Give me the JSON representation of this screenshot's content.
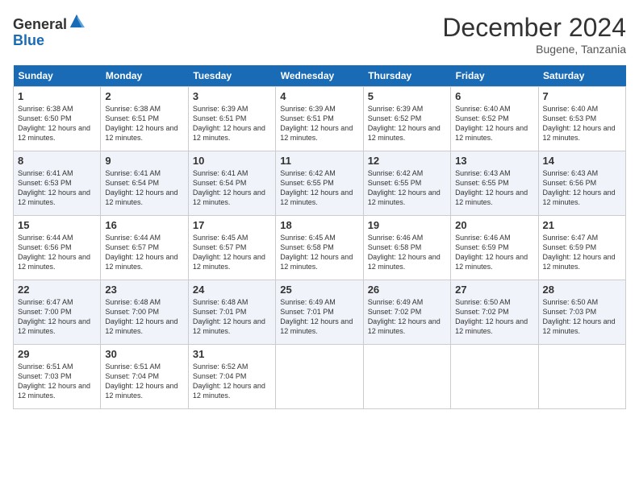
{
  "logo": {
    "general": "General",
    "blue": "Blue"
  },
  "title": "December 2024",
  "location": "Bugene, Tanzania",
  "days_of_week": [
    "Sunday",
    "Monday",
    "Tuesday",
    "Wednesday",
    "Thursday",
    "Friday",
    "Saturday"
  ],
  "weeks": [
    [
      {
        "day": "1",
        "sunrise": "Sunrise: 6:38 AM",
        "sunset": "Sunset: 6:50 PM",
        "daylight": "Daylight: 12 hours and 12 minutes."
      },
      {
        "day": "2",
        "sunrise": "Sunrise: 6:38 AM",
        "sunset": "Sunset: 6:51 PM",
        "daylight": "Daylight: 12 hours and 12 minutes."
      },
      {
        "day": "3",
        "sunrise": "Sunrise: 6:39 AM",
        "sunset": "Sunset: 6:51 PM",
        "daylight": "Daylight: 12 hours and 12 minutes."
      },
      {
        "day": "4",
        "sunrise": "Sunrise: 6:39 AM",
        "sunset": "Sunset: 6:51 PM",
        "daylight": "Daylight: 12 hours and 12 minutes."
      },
      {
        "day": "5",
        "sunrise": "Sunrise: 6:39 AM",
        "sunset": "Sunset: 6:52 PM",
        "daylight": "Daylight: 12 hours and 12 minutes."
      },
      {
        "day": "6",
        "sunrise": "Sunrise: 6:40 AM",
        "sunset": "Sunset: 6:52 PM",
        "daylight": "Daylight: 12 hours and 12 minutes."
      },
      {
        "day": "7",
        "sunrise": "Sunrise: 6:40 AM",
        "sunset": "Sunset: 6:53 PM",
        "daylight": "Daylight: 12 hours and 12 minutes."
      }
    ],
    [
      {
        "day": "8",
        "sunrise": "Sunrise: 6:41 AM",
        "sunset": "Sunset: 6:53 PM",
        "daylight": "Daylight: 12 hours and 12 minutes."
      },
      {
        "day": "9",
        "sunrise": "Sunrise: 6:41 AM",
        "sunset": "Sunset: 6:54 PM",
        "daylight": "Daylight: 12 hours and 12 minutes."
      },
      {
        "day": "10",
        "sunrise": "Sunrise: 6:41 AM",
        "sunset": "Sunset: 6:54 PM",
        "daylight": "Daylight: 12 hours and 12 minutes."
      },
      {
        "day": "11",
        "sunrise": "Sunrise: 6:42 AM",
        "sunset": "Sunset: 6:55 PM",
        "daylight": "Daylight: 12 hours and 12 minutes."
      },
      {
        "day": "12",
        "sunrise": "Sunrise: 6:42 AM",
        "sunset": "Sunset: 6:55 PM",
        "daylight": "Daylight: 12 hours and 12 minutes."
      },
      {
        "day": "13",
        "sunrise": "Sunrise: 6:43 AM",
        "sunset": "Sunset: 6:55 PM",
        "daylight": "Daylight: 12 hours and 12 minutes."
      },
      {
        "day": "14",
        "sunrise": "Sunrise: 6:43 AM",
        "sunset": "Sunset: 6:56 PM",
        "daylight": "Daylight: 12 hours and 12 minutes."
      }
    ],
    [
      {
        "day": "15",
        "sunrise": "Sunrise: 6:44 AM",
        "sunset": "Sunset: 6:56 PM",
        "daylight": "Daylight: 12 hours and 12 minutes."
      },
      {
        "day": "16",
        "sunrise": "Sunrise: 6:44 AM",
        "sunset": "Sunset: 6:57 PM",
        "daylight": "Daylight: 12 hours and 12 minutes."
      },
      {
        "day": "17",
        "sunrise": "Sunrise: 6:45 AM",
        "sunset": "Sunset: 6:57 PM",
        "daylight": "Daylight: 12 hours and 12 minutes."
      },
      {
        "day": "18",
        "sunrise": "Sunrise: 6:45 AM",
        "sunset": "Sunset: 6:58 PM",
        "daylight": "Daylight: 12 hours and 12 minutes."
      },
      {
        "day": "19",
        "sunrise": "Sunrise: 6:46 AM",
        "sunset": "Sunset: 6:58 PM",
        "daylight": "Daylight: 12 hours and 12 minutes."
      },
      {
        "day": "20",
        "sunrise": "Sunrise: 6:46 AM",
        "sunset": "Sunset: 6:59 PM",
        "daylight": "Daylight: 12 hours and 12 minutes."
      },
      {
        "day": "21",
        "sunrise": "Sunrise: 6:47 AM",
        "sunset": "Sunset: 6:59 PM",
        "daylight": "Daylight: 12 hours and 12 minutes."
      }
    ],
    [
      {
        "day": "22",
        "sunrise": "Sunrise: 6:47 AM",
        "sunset": "Sunset: 7:00 PM",
        "daylight": "Daylight: 12 hours and 12 minutes."
      },
      {
        "day": "23",
        "sunrise": "Sunrise: 6:48 AM",
        "sunset": "Sunset: 7:00 PM",
        "daylight": "Daylight: 12 hours and 12 minutes."
      },
      {
        "day": "24",
        "sunrise": "Sunrise: 6:48 AM",
        "sunset": "Sunset: 7:01 PM",
        "daylight": "Daylight: 12 hours and 12 minutes."
      },
      {
        "day": "25",
        "sunrise": "Sunrise: 6:49 AM",
        "sunset": "Sunset: 7:01 PM",
        "daylight": "Daylight: 12 hours and 12 minutes."
      },
      {
        "day": "26",
        "sunrise": "Sunrise: 6:49 AM",
        "sunset": "Sunset: 7:02 PM",
        "daylight": "Daylight: 12 hours and 12 minutes."
      },
      {
        "day": "27",
        "sunrise": "Sunrise: 6:50 AM",
        "sunset": "Sunset: 7:02 PM",
        "daylight": "Daylight: 12 hours and 12 minutes."
      },
      {
        "day": "28",
        "sunrise": "Sunrise: 6:50 AM",
        "sunset": "Sunset: 7:03 PM",
        "daylight": "Daylight: 12 hours and 12 minutes."
      }
    ],
    [
      {
        "day": "29",
        "sunrise": "Sunrise: 6:51 AM",
        "sunset": "Sunset: 7:03 PM",
        "daylight": "Daylight: 12 hours and 12 minutes."
      },
      {
        "day": "30",
        "sunrise": "Sunrise: 6:51 AM",
        "sunset": "Sunset: 7:04 PM",
        "daylight": "Daylight: 12 hours and 12 minutes."
      },
      {
        "day": "31",
        "sunrise": "Sunrise: 6:52 AM",
        "sunset": "Sunset: 7:04 PM",
        "daylight": "Daylight: 12 hours and 12 minutes."
      },
      null,
      null,
      null,
      null
    ]
  ]
}
